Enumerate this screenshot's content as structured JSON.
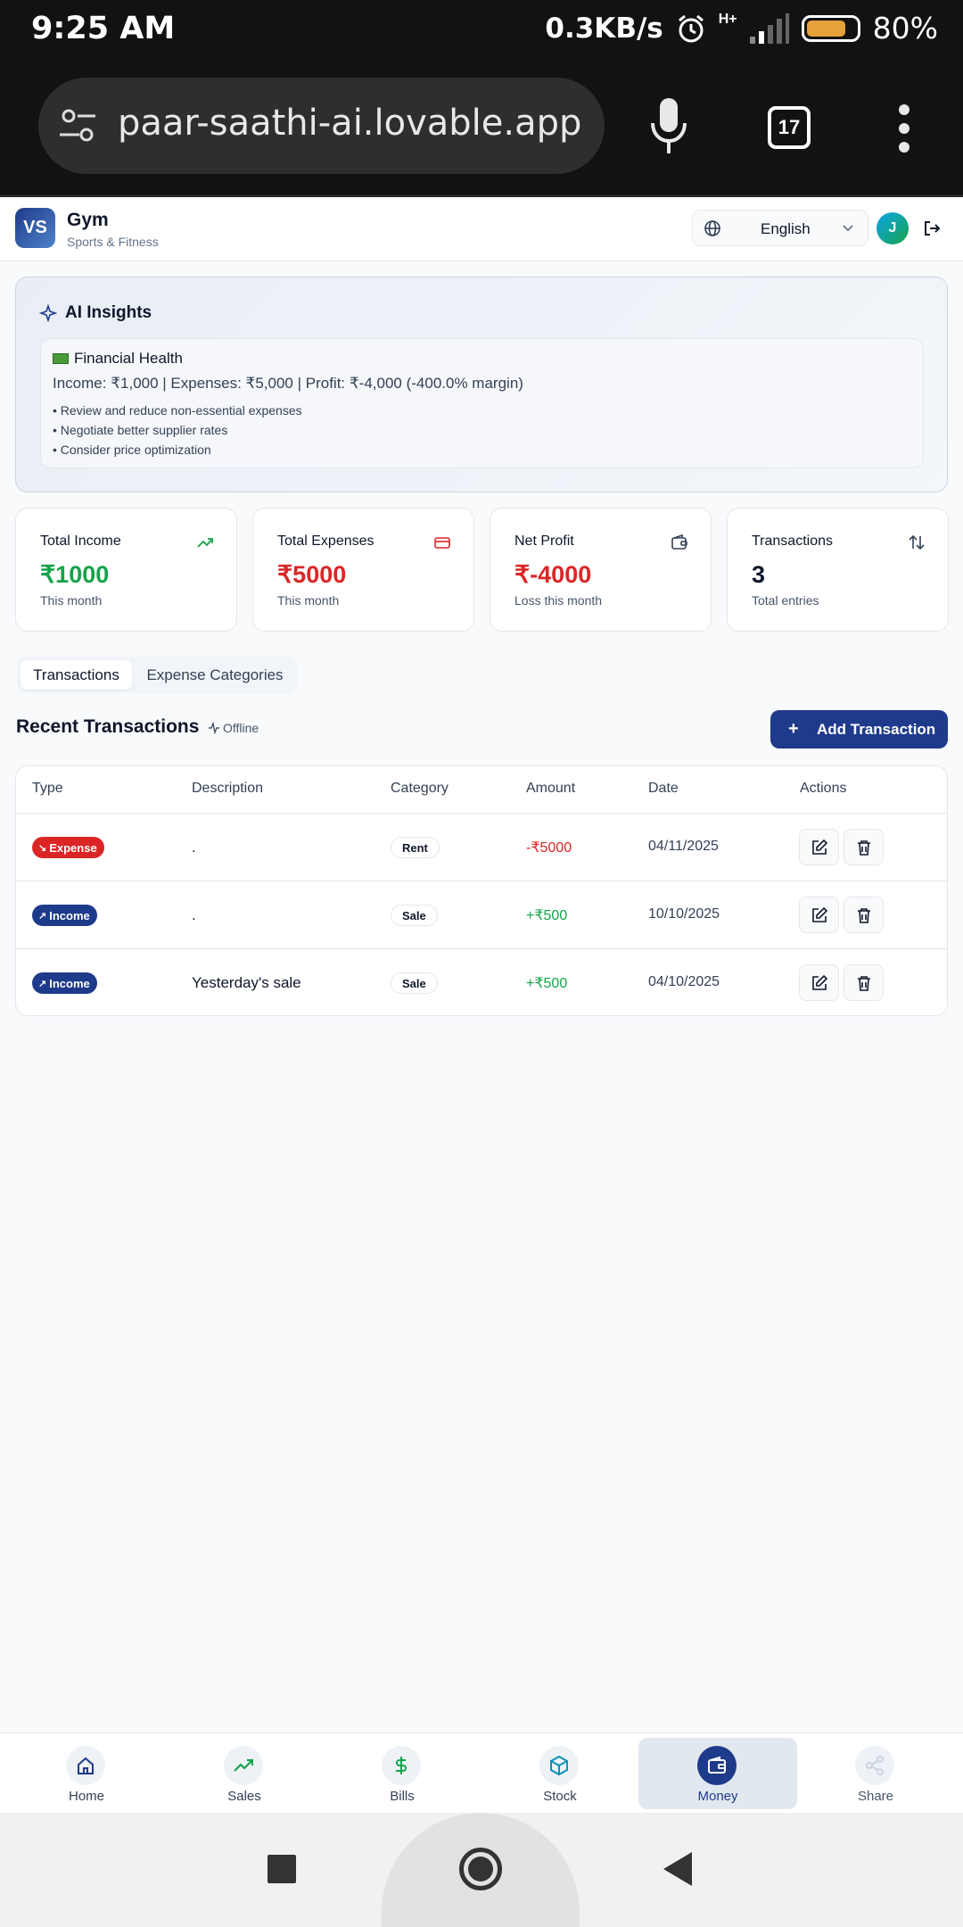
{
  "status_bar": {
    "time": "9:25 AM",
    "speed": "0.3KB/s",
    "network": "H+",
    "battery_pct": "80%",
    "battery_level": 0.8
  },
  "browser": {
    "url": "paar-saathi-ai.lovable.app",
    "tab_count": "17"
  },
  "header": {
    "logo": "VS",
    "business_name": "Gym",
    "business_category": "Sports & Fitness",
    "language": "English",
    "avatar": "J"
  },
  "ai_insights": {
    "title": "AI Insights",
    "section_title": "Financial Health",
    "summary": "Income: ₹1,000 | Expenses: ₹5,000 | Profit: ₹-4,000 (-400.0% margin)",
    "tips": [
      "• Review and reduce non-essential expenses",
      "• Negotiate better supplier rates",
      "• Consider price optimization"
    ]
  },
  "stats": [
    {
      "label": "Total Income",
      "value": "₹1000",
      "sub": "This month",
      "color": "#16a34a"
    },
    {
      "label": "Total Expenses",
      "value": "₹5000",
      "sub": "This month",
      "color": "#dc2626"
    },
    {
      "label": "Net Profit",
      "value": "₹-4000",
      "sub": "Loss this month",
      "color": "#dc2626"
    },
    {
      "label": "Transactions",
      "value": "3",
      "sub": "Total entries",
      "color": "#0f172a"
    }
  ],
  "tabs": [
    "Transactions",
    "Expense Categories"
  ],
  "transactions": {
    "title": "Recent Transactions",
    "status": "Offline",
    "add_label": "Add Transaction",
    "columns": [
      "Type",
      "Description",
      "Category",
      "Amount",
      "Date",
      "Actions"
    ],
    "rows": [
      {
        "type": "Expense",
        "description": ".",
        "category": "Rent",
        "amount": "-₹5000",
        "date": "04/11/2025"
      },
      {
        "type": "Income",
        "description": ".",
        "category": "Sale",
        "amount": "+₹500",
        "date": "10/10/2025"
      },
      {
        "type": "Income",
        "description": "Yesterday's sale",
        "category": "Sale",
        "amount": "+₹500",
        "date": "04/10/2025"
      }
    ]
  },
  "nav": [
    {
      "label": "Home"
    },
    {
      "label": "Sales"
    },
    {
      "label": "Bills"
    },
    {
      "label": "Stock"
    },
    {
      "label": "Money"
    },
    {
      "label": "Share"
    }
  ],
  "colors": {
    "primary": "#1e3a8a",
    "income": "#16a34a",
    "expense": "#dc2626"
  }
}
